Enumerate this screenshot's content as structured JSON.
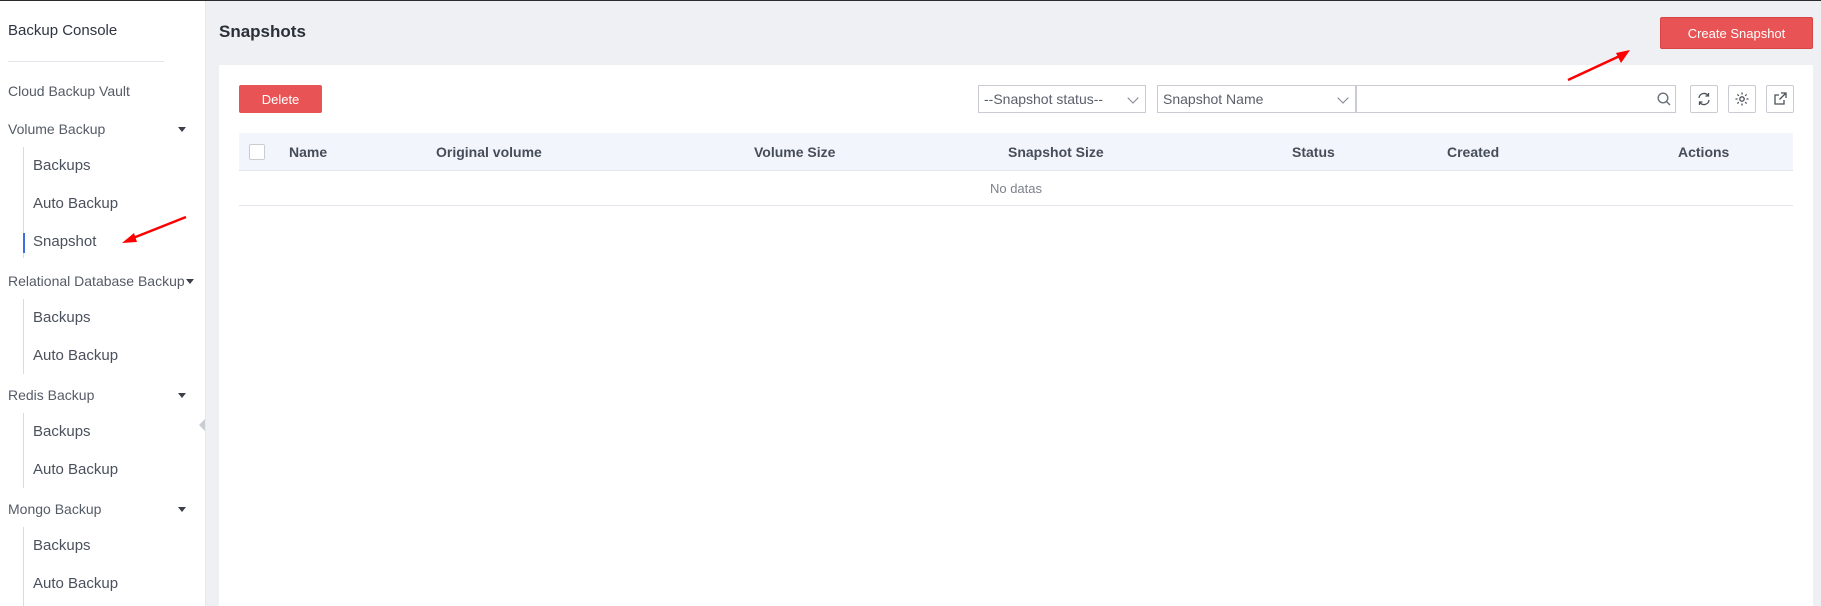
{
  "sidebar": {
    "console_title": "Backup Console",
    "top_item": "Cloud Backup Vault",
    "groups": [
      {
        "label": "Volume Backup",
        "items": [
          "Backups",
          "Auto Backup",
          "Snapshot"
        ]
      },
      {
        "label": "Relational Database Backup",
        "items": [
          "Backups",
          "Auto Backup"
        ]
      },
      {
        "label": "Redis Backup",
        "items": [
          "Backups",
          "Auto Backup"
        ]
      },
      {
        "label": "Mongo Backup",
        "items": [
          "Backups",
          "Auto Backup"
        ]
      }
    ],
    "active_item": "Snapshot"
  },
  "header": {
    "title": "Snapshots",
    "create_button": "Create Snapshot"
  },
  "toolbar": {
    "delete_button": "Delete",
    "status_select": "--Snapshot status--",
    "field_select": "Snapshot Name",
    "search_value": ""
  },
  "table": {
    "columns": [
      "Name",
      "Original volume",
      "Volume Size",
      "Snapshot Size",
      "Status",
      "Created",
      "Actions"
    ],
    "empty_text": "No datas"
  },
  "colors": {
    "primary_red": "#e85456",
    "active_blue": "#3b6fe0",
    "annotation_red": "#ff0000"
  }
}
